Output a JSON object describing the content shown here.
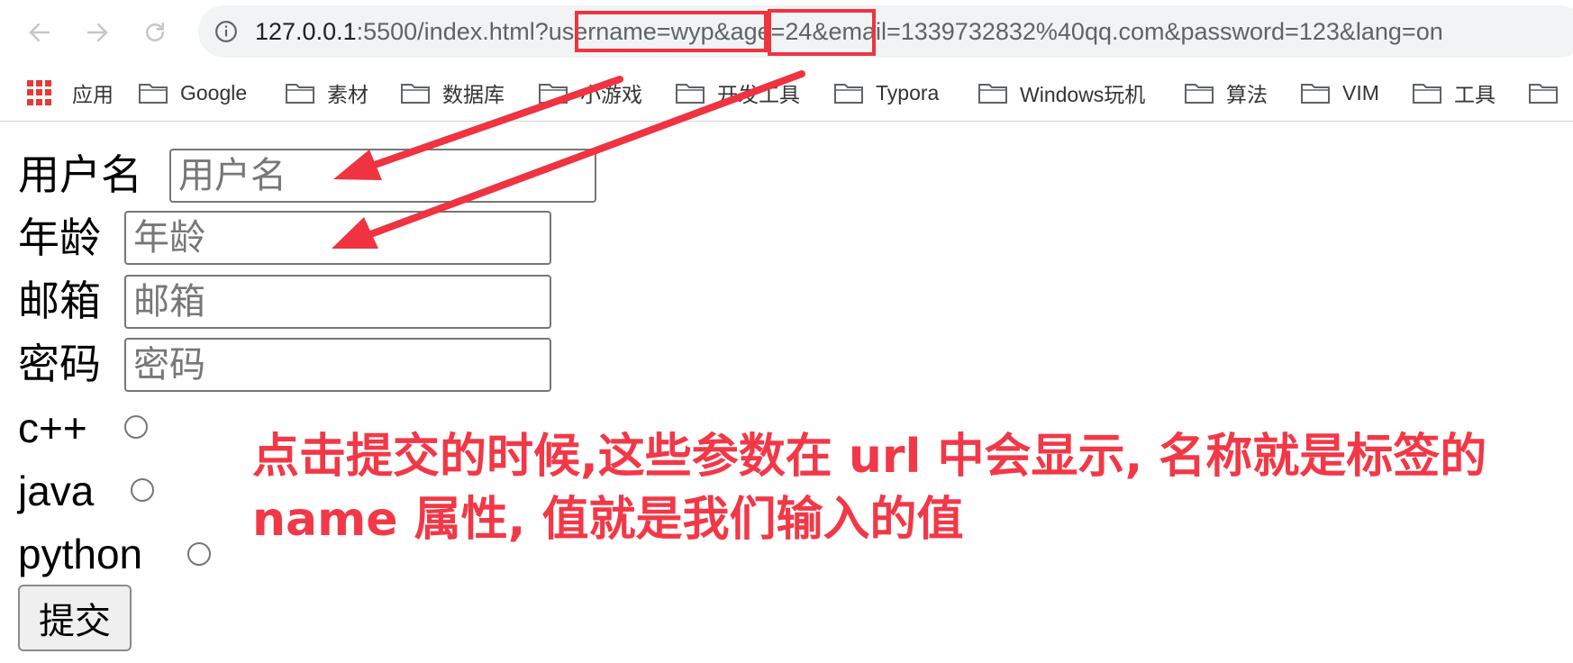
{
  "browser": {
    "url_host": "127.0.0.1",
    "url_rest": ":5500/index.html?username=wyp&age=24&email=1339732832%40qq.com&password=123&lang=on",
    "bookmarks": [
      {
        "label": "应用",
        "icon": "apps-grid-icon"
      },
      {
        "label": "Google",
        "icon": "folder-icon"
      },
      {
        "label": "素材",
        "icon": "folder-icon"
      },
      {
        "label": "数据库",
        "icon": "folder-icon"
      },
      {
        "label": "小游戏",
        "icon": "folder-icon"
      },
      {
        "label": "开发工具",
        "icon": "folder-icon"
      },
      {
        "label": "Typora",
        "icon": "folder-icon"
      },
      {
        "label": "Windows玩机",
        "icon": "folder-icon"
      },
      {
        "label": "算法",
        "icon": "folder-icon"
      },
      {
        "label": "VIM",
        "icon": "folder-icon"
      },
      {
        "label": "工具",
        "icon": "folder-icon"
      }
    ]
  },
  "form": {
    "username": {
      "label": "用户名",
      "placeholder": "用户名",
      "value": ""
    },
    "age": {
      "label": "年龄",
      "placeholder": "年龄",
      "value": ""
    },
    "email": {
      "label": "邮箱",
      "placeholder": "邮箱",
      "value": ""
    },
    "password": {
      "label": "密码",
      "placeholder": "密码",
      "value": ""
    },
    "languages": [
      "c++",
      "java",
      "python"
    ],
    "submit_label": "提交"
  },
  "annotation": {
    "text": "点击提交的时候,这些参数在 url 中会显示, 名称就是标签的 name 属性, 值就是我们输入的值",
    "color": "#f23847"
  }
}
